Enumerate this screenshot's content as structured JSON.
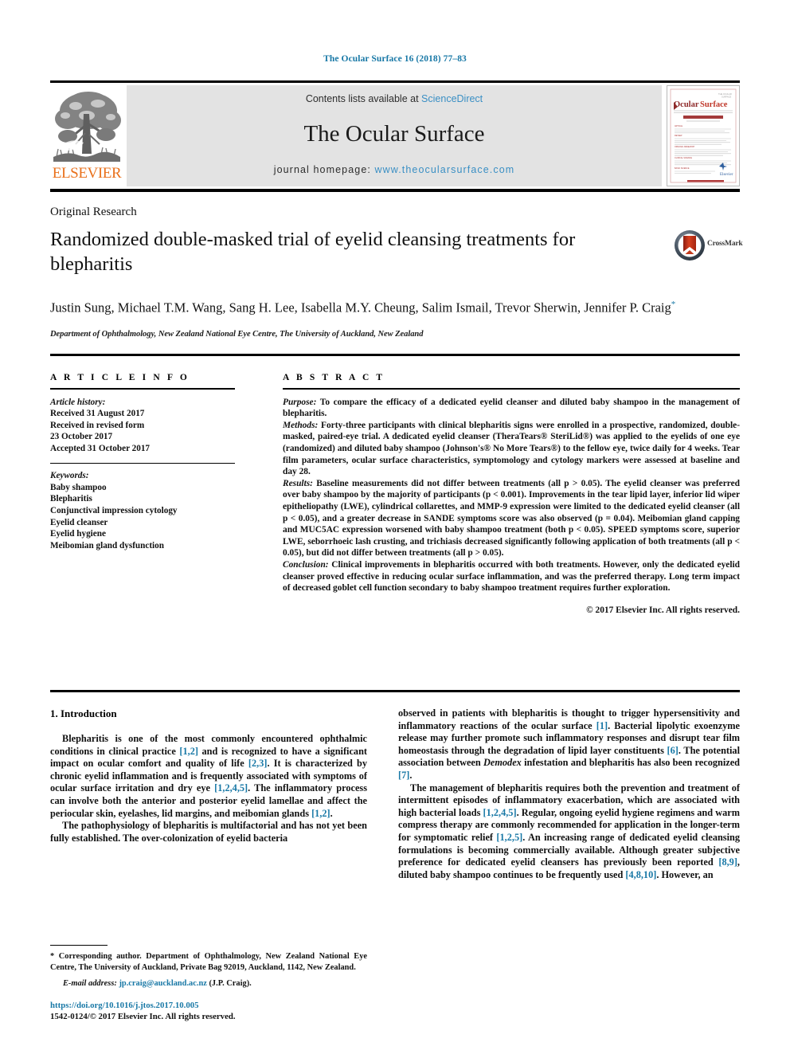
{
  "running_head": "The Ocular Surface 16 (2018) 77–83",
  "banner": {
    "contents_prefix": "Contents lists available at",
    "sciencedirect": "ScienceDirect",
    "journal_title": "The Ocular Surface",
    "homepage_prefix": "journal homepage:",
    "homepage_url": "www.theocularsurface.com",
    "publisher_logo_text": "ELSEVIER",
    "publisher_logo_icon": "elsevier-tree-icon",
    "cover_thumb_title": "Ocular Surface",
    "cover_thumb_icon": "journal-cover-thumbnail"
  },
  "article": {
    "type": "Original Research",
    "title": "Randomized double-masked trial of eyelid cleansing treatments for blepharitis",
    "crossmark_label": "CrossMark",
    "authors": "Justin Sung, Michael T.M. Wang, Sang H. Lee, Isabella M.Y. Cheung, Salim Ismail, Trevor Sherwin, Jennifer P. Craig",
    "corresponding_marker": "*",
    "affiliation": "Department of Ophthalmology, New Zealand National Eye Centre, The University of Auckland, New Zealand"
  },
  "info": {
    "heading": "A R T I C L E   I N F O",
    "history_label": "Article history:",
    "history": [
      "Received 31 August 2017",
      "Received in revised form",
      "23 October 2017",
      "Accepted 31 October 2017"
    ],
    "keywords_label": "Keywords:",
    "keywords": [
      "Baby shampoo",
      "Blepharitis",
      "Conjunctival impression cytology",
      "Eyelid cleanser",
      "Eyelid hygiene",
      "Meibomian gland dysfunction"
    ]
  },
  "abstract": {
    "heading": "A B S T R A C T",
    "purpose_label": "Purpose:",
    "purpose_text": " To compare the efficacy of a dedicated eyelid cleanser and diluted baby shampoo in the management of blepharitis.",
    "methods_label": "Methods:",
    "methods_text": " Forty-three participants with clinical blepharitis signs were enrolled in a prospective, randomized, double-masked, paired-eye trial. A dedicated eyelid cleanser (TheraTears® SteriLid®) was applied to the eyelids of one eye (randomized) and diluted baby shampoo (Johnson's® No More Tears®) to the fellow eye, twice daily for 4 weeks. Tear film parameters, ocular surface characteristics, symptomology and cytology markers were assessed at baseline and day 28.",
    "results_label": "Results:",
    "results_text": " Baseline measurements did not differ between treatments (all p > 0.05). The eyelid cleanser was preferred over baby shampoo by the majority of participants (p < 0.001). Improvements in the tear lipid layer, inferior lid wiper epitheliopathy (LWE), cylindrical collarettes, and MMP-9 expression were limited to the dedicated eyelid cleanser (all p < 0.05), and a greater decrease in SANDE symptoms score was also observed (p = 0.04). Meibomian gland capping and MUC5AC expression worsened with baby shampoo treatment (both p < 0.05). SPEED symptoms score, superior LWE, seborrhoeic lash crusting, and trichiasis decreased significantly following application of both treatments (all p < 0.05), but did not differ between treatments (all p > 0.05).",
    "conclusion_label": "Conclusion:",
    "conclusion_text": " Clinical improvements in blepharitis occurred with both treatments. However, only the dedicated eyelid cleanser proved effective in reducing ocular surface inflammation, and was the preferred therapy. Long term impact of decreased goblet cell function secondary to baby shampoo treatment requires further exploration.",
    "copyright": "© 2017 Elsevier Inc. All rights reserved."
  },
  "body": {
    "section_heading": "1. Introduction",
    "left_para_1": [
      "Blepharitis is one of the most commonly encountered ophthalmic conditions in clinical practice ",
      "[1,2]",
      " and is recognized to have a significant impact on ocular comfort and quality of life ",
      "[2,3]",
      ". It is characterized by chronic eyelid inflammation and is frequently associated with symptoms of ocular surface irritation and dry eye ",
      "[1,2,4,5]",
      ". The inflammatory process can involve both the anterior and posterior eyelid lamellae and affect the periocular skin, eyelashes, lid margins, and meibomian glands ",
      "[1,2]",
      "."
    ],
    "left_para_2": "The pathophysiology of blepharitis is multifactorial and has not yet been fully established. The over-colonization of eyelid bacteria",
    "right_para_1": [
      "observed in patients with blepharitis is thought to trigger hypersensitivity and inflammatory reactions of the ocular surface ",
      "[1]",
      ". Bacterial lipolytic exoenzyme release may further promote such inflammatory responses and disrupt tear film homeostasis through the degradation of lipid layer constituents ",
      "[6]",
      ". The potential association between ",
      "Demodex",
      " infestation and blepharitis has also been recognized ",
      "[7]",
      "."
    ],
    "right_para_2": [
      "The management of blepharitis requires both the prevention and treatment of intermittent episodes of inflammatory exacerbation, which are associated with high bacterial loads ",
      "[1,2,4,5]",
      ". Regular, ongoing eyelid hygiene regimens and warm compress therapy are commonly recommended for application in the longer-term for symptomatic relief ",
      "[1,2,5]",
      ". An increasing range of dedicated eyelid cleansing formulations is becoming commercially available. Although greater subjective preference for dedicated eyelid cleansers has previously been reported ",
      "[8,9]",
      ", diluted baby shampoo continues to be frequently used ",
      "[4,8,10]",
      ". However, an"
    ]
  },
  "footer": {
    "corresponding_marker": "*",
    "corresponding_text": " Corresponding author. Department of Ophthalmology, New Zealand National Eye Centre, The University of Auckland, Private Bag 92019, Auckland, 1142, New Zealand.",
    "email_label": "E-mail address:",
    "email": "jp.craig@auckland.ac.nz",
    "email_suffix": " (J.P. Craig).",
    "doi": "https://doi.org/10.1016/j.jtos.2017.10.005",
    "issn_line": "1542-0124/© 2017 Elsevier Inc. All rights reserved."
  },
  "colors": {
    "link": "#1878a6",
    "sciencedirect": "#3a8fc4",
    "elsevier_orange": "#E9711C",
    "banner_grey": "#e3e3e3"
  }
}
